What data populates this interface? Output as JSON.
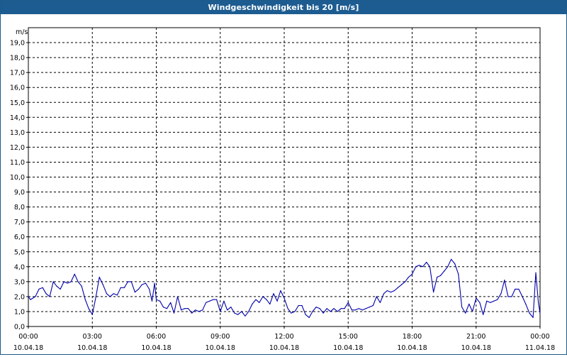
{
  "window": {
    "title": "Windgeschwindigkeit bis 20 [m/s]"
  },
  "chart_data": {
    "type": "line",
    "title": "Windgeschwindigkeit bis 20 [m/s]",
    "xlabel": "",
    "ylabel": "m/s",
    "ylim": [
      0,
      20
    ],
    "y_ticks": [
      "0,0",
      "1,0",
      "2,0",
      "3,0",
      "4,0",
      "5,0",
      "6,0",
      "7,0",
      "8,0",
      "9,0",
      "10,0",
      "11,0",
      "12,0",
      "13,0",
      "14,0",
      "15,0",
      "16,0",
      "17,0",
      "18,0",
      "19,0"
    ],
    "x_range_hours": [
      0,
      24
    ],
    "x_ticks": [
      {
        "time": "00:00",
        "date": "10.04.18"
      },
      {
        "time": "03:00",
        "date": "10.04.18"
      },
      {
        "time": "06:00",
        "date": "10.04.18"
      },
      {
        "time": "09:00",
        "date": "10.04.18"
      },
      {
        "time": "12:00",
        "date": "10.04.18"
      },
      {
        "time": "15:00",
        "date": "10.04.18"
      },
      {
        "time": "18:00",
        "date": "10.04.18"
      },
      {
        "time": "21:00",
        "date": "10.04.18"
      },
      {
        "time": "00:00",
        "date": "11.04.18"
      }
    ],
    "grid": true,
    "line_color": "#0000aa",
    "series": [
      {
        "x": [
          0.0,
          0.1,
          0.33,
          0.5,
          0.67,
          0.83,
          1.0,
          1.17,
          1.33,
          1.5,
          1.67,
          1.83,
          2.0,
          2.17,
          2.33,
          2.5,
          2.67,
          2.83,
          3.0,
          3.17,
          3.33,
          3.5,
          3.67,
          3.83,
          4.0,
          4.17,
          4.33,
          4.5,
          4.67,
          4.83,
          5.0,
          5.17,
          5.33,
          5.5,
          5.67,
          5.8,
          5.92,
          6.0,
          6.17,
          6.33,
          6.5,
          6.67,
          6.83,
          7.0,
          7.17,
          7.33,
          7.5,
          7.67,
          7.83,
          8.0,
          8.17,
          8.33,
          8.5,
          8.67,
          8.83,
          9.0,
          9.17,
          9.33,
          9.5,
          9.67,
          9.83,
          10.0,
          10.17,
          10.33,
          10.5,
          10.67,
          10.83,
          11.0,
          11.17,
          11.33,
          11.5,
          11.67,
          11.83,
          12.0,
          12.17,
          12.33,
          12.5,
          12.67,
          12.83,
          13.0,
          13.17,
          13.33,
          13.5,
          13.67,
          13.83,
          14.0,
          14.17,
          14.33,
          14.5,
          14.67,
          14.83,
          15.0,
          15.17,
          15.33,
          15.5,
          15.67,
          15.83,
          16.0,
          16.17,
          16.33,
          16.5,
          16.67,
          16.83,
          17.0,
          17.17,
          17.33,
          17.5,
          17.67,
          17.83,
          18.0,
          18.17,
          18.33,
          18.5,
          18.67,
          18.83,
          19.0,
          19.17,
          19.33,
          19.5,
          19.67,
          19.83,
          20.0,
          20.17,
          20.33,
          20.5,
          20.67,
          20.83,
          21.0,
          21.17,
          21.33,
          21.5,
          21.67,
          21.83,
          22.0,
          22.17,
          22.33,
          22.5,
          22.67,
          22.83,
          23.0,
          23.17,
          23.33,
          23.5,
          23.67,
          23.8,
          23.92,
          24.0
        ],
        "y": [
          2.0,
          1.8,
          2.0,
          2.5,
          2.6,
          2.2,
          2.0,
          3.0,
          2.7,
          2.5,
          3.0,
          2.9,
          3.0,
          3.5,
          3.0,
          2.7,
          1.8,
          1.2,
          0.8,
          2.0,
          3.3,
          2.8,
          2.2,
          2.0,
          2.2,
          2.1,
          2.6,
          2.6,
          3.0,
          3.0,
          2.3,
          2.5,
          2.8,
          2.9,
          2.5,
          1.7,
          2.9,
          1.8,
          1.7,
          1.3,
          1.2,
          1.6,
          0.9,
          2.0,
          1.1,
          1.2,
          1.2,
          0.9,
          1.1,
          1.0,
          1.1,
          1.6,
          1.7,
          1.8,
          1.8,
          1.0,
          1.7,
          1.1,
          1.3,
          0.9,
          0.8,
          1.0,
          0.7,
          1.0,
          1.5,
          1.8,
          1.6,
          2.0,
          1.8,
          1.5,
          2.2,
          1.7,
          2.4,
          1.9,
          1.2,
          0.9,
          1.0,
          1.4,
          1.4,
          0.8,
          0.6,
          1.0,
          1.3,
          1.2,
          0.9,
          1.2,
          1.0,
          1.2,
          1.0,
          1.2,
          1.2,
          1.6,
          1.1,
          1.1,
          1.2,
          1.1,
          1.2,
          1.3,
          1.4,
          2.0,
          1.6,
          2.2,
          2.4,
          2.3,
          2.4,
          2.6,
          2.8,
          3.0,
          3.3,
          3.5,
          4.0,
          4.1,
          4.0,
          4.3,
          4.0,
          2.3,
          3.3,
          3.4,
          3.7,
          4.0,
          4.5,
          4.2,
          3.5,
          1.3,
          0.9,
          1.5,
          1.0,
          1.9,
          1.6,
          0.8,
          1.7,
          1.6,
          1.7,
          1.8,
          2.2,
          3.1,
          2.0,
          2.0,
          2.5,
          2.5,
          2.0,
          1.5,
          0.9,
          0.6,
          3.6,
          1.6,
          0.9
        ]
      }
    ]
  }
}
